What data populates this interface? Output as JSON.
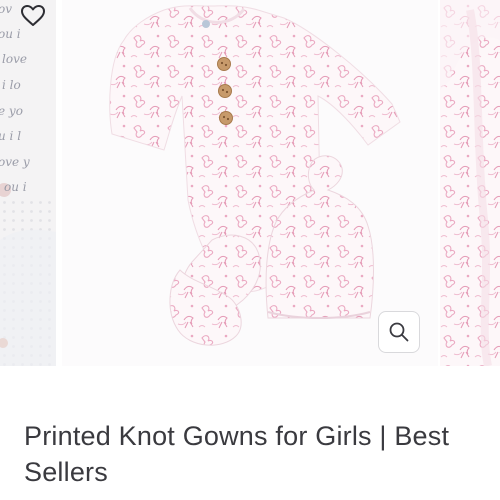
{
  "product": {
    "title": "Printed Knot Gowns for Girls | Best Sellers"
  },
  "gallery": {
    "left_slide_script": [
      "ov",
      "ou i",
      "love",
      "i lo",
      "e yo",
      "u i l",
      "ove y",
      "ou i"
    ],
    "icons": {
      "favorite_left": "heart-outline-icon",
      "favorite_main": "heart-outline-icon",
      "zoom": "magnifier-icon"
    }
  },
  "colors": {
    "print_pink": "#eba9c2",
    "background": "#ffffff",
    "title_text": "#3a3a3f",
    "button_border": "#d9d9dc"
  }
}
